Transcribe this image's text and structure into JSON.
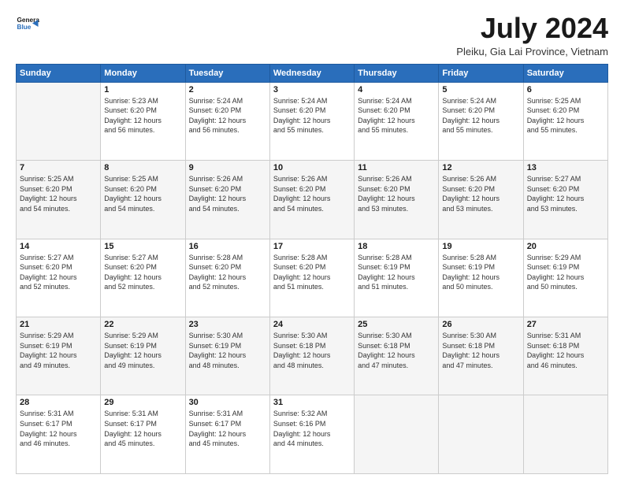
{
  "logo": {
    "line1": "General",
    "line2": "Blue"
  },
  "title": "July 2024",
  "subtitle": "Pleiku, Gia Lai Province, Vietnam",
  "days_of_week": [
    "Sunday",
    "Monday",
    "Tuesday",
    "Wednesday",
    "Thursday",
    "Friday",
    "Saturday"
  ],
  "weeks": [
    [
      {
        "day": "",
        "info": ""
      },
      {
        "day": "1",
        "info": "Sunrise: 5:23 AM\nSunset: 6:20 PM\nDaylight: 12 hours\nand 56 minutes."
      },
      {
        "day": "2",
        "info": "Sunrise: 5:24 AM\nSunset: 6:20 PM\nDaylight: 12 hours\nand 56 minutes."
      },
      {
        "day": "3",
        "info": "Sunrise: 5:24 AM\nSunset: 6:20 PM\nDaylight: 12 hours\nand 55 minutes."
      },
      {
        "day": "4",
        "info": "Sunrise: 5:24 AM\nSunset: 6:20 PM\nDaylight: 12 hours\nand 55 minutes."
      },
      {
        "day": "5",
        "info": "Sunrise: 5:24 AM\nSunset: 6:20 PM\nDaylight: 12 hours\nand 55 minutes."
      },
      {
        "day": "6",
        "info": "Sunrise: 5:25 AM\nSunset: 6:20 PM\nDaylight: 12 hours\nand 55 minutes."
      }
    ],
    [
      {
        "day": "7",
        "info": "Sunrise: 5:25 AM\nSunset: 6:20 PM\nDaylight: 12 hours\nand 54 minutes."
      },
      {
        "day": "8",
        "info": "Sunrise: 5:25 AM\nSunset: 6:20 PM\nDaylight: 12 hours\nand 54 minutes."
      },
      {
        "day": "9",
        "info": "Sunrise: 5:26 AM\nSunset: 6:20 PM\nDaylight: 12 hours\nand 54 minutes."
      },
      {
        "day": "10",
        "info": "Sunrise: 5:26 AM\nSunset: 6:20 PM\nDaylight: 12 hours\nand 54 minutes."
      },
      {
        "day": "11",
        "info": "Sunrise: 5:26 AM\nSunset: 6:20 PM\nDaylight: 12 hours\nand 53 minutes."
      },
      {
        "day": "12",
        "info": "Sunrise: 5:26 AM\nSunset: 6:20 PM\nDaylight: 12 hours\nand 53 minutes."
      },
      {
        "day": "13",
        "info": "Sunrise: 5:27 AM\nSunset: 6:20 PM\nDaylight: 12 hours\nand 53 minutes."
      }
    ],
    [
      {
        "day": "14",
        "info": "Sunrise: 5:27 AM\nSunset: 6:20 PM\nDaylight: 12 hours\nand 52 minutes."
      },
      {
        "day": "15",
        "info": "Sunrise: 5:27 AM\nSunset: 6:20 PM\nDaylight: 12 hours\nand 52 minutes."
      },
      {
        "day": "16",
        "info": "Sunrise: 5:28 AM\nSunset: 6:20 PM\nDaylight: 12 hours\nand 52 minutes."
      },
      {
        "day": "17",
        "info": "Sunrise: 5:28 AM\nSunset: 6:20 PM\nDaylight: 12 hours\nand 51 minutes."
      },
      {
        "day": "18",
        "info": "Sunrise: 5:28 AM\nSunset: 6:19 PM\nDaylight: 12 hours\nand 51 minutes."
      },
      {
        "day": "19",
        "info": "Sunrise: 5:28 AM\nSunset: 6:19 PM\nDaylight: 12 hours\nand 50 minutes."
      },
      {
        "day": "20",
        "info": "Sunrise: 5:29 AM\nSunset: 6:19 PM\nDaylight: 12 hours\nand 50 minutes."
      }
    ],
    [
      {
        "day": "21",
        "info": "Sunrise: 5:29 AM\nSunset: 6:19 PM\nDaylight: 12 hours\nand 49 minutes."
      },
      {
        "day": "22",
        "info": "Sunrise: 5:29 AM\nSunset: 6:19 PM\nDaylight: 12 hours\nand 49 minutes."
      },
      {
        "day": "23",
        "info": "Sunrise: 5:30 AM\nSunset: 6:19 PM\nDaylight: 12 hours\nand 48 minutes."
      },
      {
        "day": "24",
        "info": "Sunrise: 5:30 AM\nSunset: 6:18 PM\nDaylight: 12 hours\nand 48 minutes."
      },
      {
        "day": "25",
        "info": "Sunrise: 5:30 AM\nSunset: 6:18 PM\nDaylight: 12 hours\nand 47 minutes."
      },
      {
        "day": "26",
        "info": "Sunrise: 5:30 AM\nSunset: 6:18 PM\nDaylight: 12 hours\nand 47 minutes."
      },
      {
        "day": "27",
        "info": "Sunrise: 5:31 AM\nSunset: 6:18 PM\nDaylight: 12 hours\nand 46 minutes."
      }
    ],
    [
      {
        "day": "28",
        "info": "Sunrise: 5:31 AM\nSunset: 6:17 PM\nDaylight: 12 hours\nand 46 minutes."
      },
      {
        "day": "29",
        "info": "Sunrise: 5:31 AM\nSunset: 6:17 PM\nDaylight: 12 hours\nand 45 minutes."
      },
      {
        "day": "30",
        "info": "Sunrise: 5:31 AM\nSunset: 6:17 PM\nDaylight: 12 hours\nand 45 minutes."
      },
      {
        "day": "31",
        "info": "Sunrise: 5:32 AM\nSunset: 6:16 PM\nDaylight: 12 hours\nand 44 minutes."
      },
      {
        "day": "",
        "info": ""
      },
      {
        "day": "",
        "info": ""
      },
      {
        "day": "",
        "info": ""
      }
    ]
  ]
}
